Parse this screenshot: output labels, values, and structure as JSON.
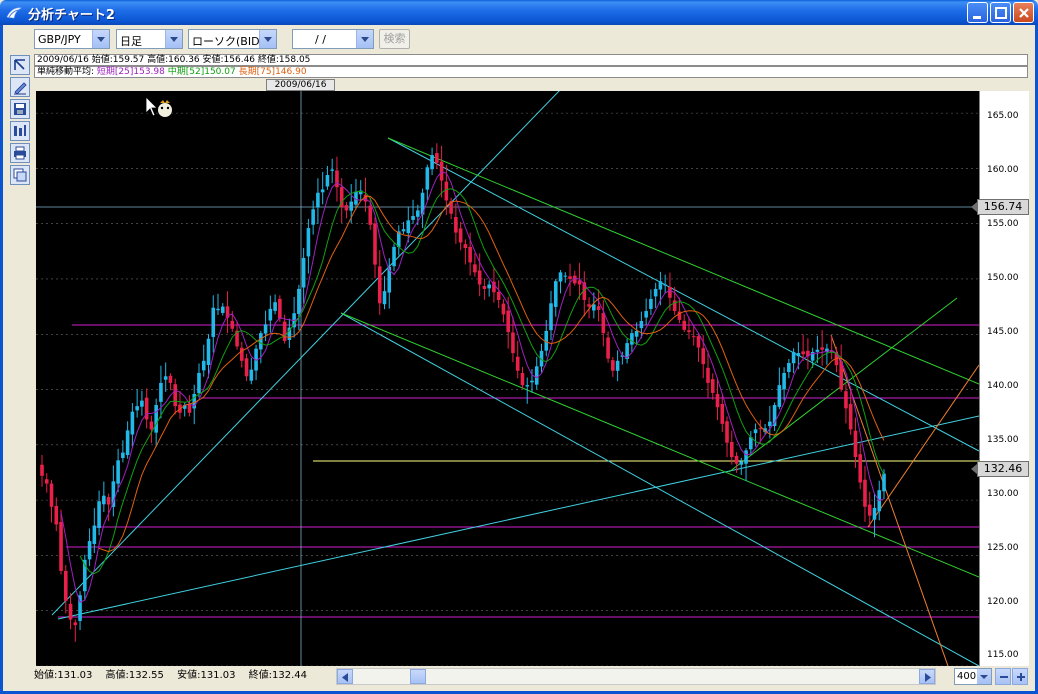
{
  "window": {
    "title": "分析チャート2"
  },
  "toolbar": {
    "pair": "GBP/JPY",
    "period": "日足",
    "chart_type": "ローソク(BID)",
    "date": " /  / ",
    "search_label": "検索"
  },
  "info": {
    "line1": "2009/06/16  始値:159.57  高値:160.36  安値:156.46  終値:158.05",
    "ma_prefix": "単純移動平均: ",
    "ma_short": "短期[25]153.98",
    "ma_mid": "中期[52]150.07",
    "ma_long": "長期[75]146.90"
  },
  "cursor_date": "2009/06/16",
  "axis": {
    "ticks": [
      "165.00",
      "160.00",
      "155.00",
      "150.00",
      "145.00",
      "140.00",
      "135.00",
      "130.00",
      "125.00",
      "120.00",
      "115.00"
    ],
    "cursor_price": "156.74",
    "last_price": "132.46"
  },
  "status": {
    "open": "始値:131.03",
    "high": "高値:132.55",
    "low": "安値:131.03",
    "close": "終値:132.44",
    "bars": "400"
  },
  "colors": {
    "up": "#22b8e8",
    "down": "#e8204a",
    "ma_short": "#a020c0",
    "ma_mid": "#10a010",
    "ma_long": "#e06010"
  },
  "chart_data": {
    "type": "candlestick",
    "ylim": [
      115,
      167
    ],
    "grid": true,
    "closes": [
      132.2,
      131.5,
      129.4,
      127.8,
      123.6,
      120.9,
      119.2,
      118.7,
      121.4,
      124.6,
      126.3,
      127.7,
      129.9,
      130.4,
      129.6,
      131.7,
      133.6,
      134.3,
      136.3,
      138.0,
      138.5,
      139.0,
      137.3,
      136.4,
      138.6,
      140.6,
      141.2,
      140.6,
      138.5,
      137.9,
      138.6,
      137.9,
      139.6,
      141.5,
      142.6,
      144.6,
      147.4,
      147.3,
      147.5,
      146.5,
      145.5,
      143.9,
      142.6,
      141.2,
      141.8,
      143.7,
      145.1,
      145.9,
      147.3,
      147.9,
      146.4,
      144.4,
      145.6,
      146.9,
      149.1,
      151.9,
      154.6,
      156.3,
      157.8,
      158.1,
      159.4,
      159.9,
      158.3,
      156.5,
      156.2,
      157.0,
      157.9,
      158.0,
      157.0,
      154.9,
      151.3,
      147.8,
      148.9,
      151.1,
      152.9,
      154.3,
      154.5,
      155.3,
      155.7,
      156.2,
      157.8,
      160.1,
      161.2,
      160.5,
      158.9,
      157.1,
      155.9,
      154.2,
      153.3,
      152.8,
      151.5,
      150.6,
      149.5,
      149.1,
      149.5,
      148.8,
      148.1,
      146.8,
      145.2,
      143.3,
      141.7,
      140.4,
      140.4,
      140.8,
      142.1,
      143.5,
      145.3,
      147.8,
      149.8,
      150.6,
      150.3,
      150.0,
      149.6,
      149.5,
      148.1,
      147.5,
      147.7,
      147.2,
      145.1,
      142.8,
      141.7,
      142.6,
      143.1,
      144.2,
      145.1,
      145.3,
      146.2,
      147.1,
      148.2,
      149.1,
      149.8,
      149.5,
      148.3,
      147.1,
      146.3,
      145.4,
      145.2,
      144.8,
      143.8,
      142.3,
      140.6,
      139.7,
      138.4,
      136.9,
      135.2,
      133.9,
      133.3,
      133.5,
      134.5,
      135.7,
      136.4,
      136.5,
      136.5,
      137.1,
      138.6,
      140.4,
      141.5,
      142.4,
      143.4,
      143.3,
      143.2,
      143.0,
      143.4,
      143.6,
      143.6,
      143.7,
      143.4,
      142.2,
      140.0,
      138.3,
      136.4,
      133.9,
      131.6,
      129.4,
      128.6,
      129.3,
      130.9,
      132.4
    ]
  }
}
